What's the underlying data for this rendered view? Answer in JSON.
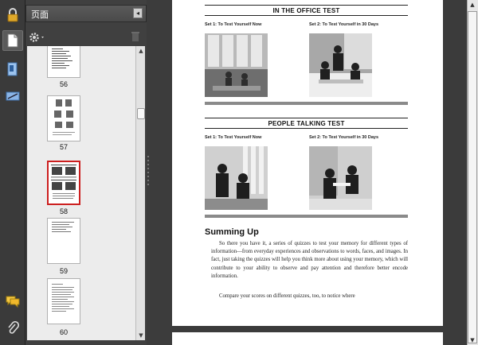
{
  "panel": {
    "title": "页面",
    "collapse_glyph": "◂",
    "gear_icon": "gear-icon",
    "trash_icon": "trash-icon"
  },
  "toolbar": {
    "items": [
      {
        "name": "lock-icon"
      },
      {
        "name": "page-thumbnails-icon"
      },
      {
        "name": "bookmark-icon"
      },
      {
        "name": "signature-icon"
      },
      {
        "name": "comment-icon"
      },
      {
        "name": "attachment-icon"
      }
    ]
  },
  "thumbnails": [
    {
      "page": "56"
    },
    {
      "page": "57"
    },
    {
      "page": "58",
      "selected": true
    },
    {
      "page": "59"
    },
    {
      "page": "60"
    }
  ],
  "document": {
    "section1": {
      "title": "IN THE OFFICE TEST",
      "set1": "Set 1: To Test Yourself Now",
      "set2": "Set 2: To Test Yourself in 30 Days"
    },
    "section2": {
      "title": "PEOPLE TALKING TEST",
      "set1": "Set 1: To Test Yourself Now",
      "set2": "Set 2: To Test Yourself in 30 Days"
    },
    "summing_up": {
      "title": "Summing Up",
      "paragraph1": "So there you have it, a series of quizzes to test your memory for different types of information—from everyday experiences and observations to words, faces, and images. In fact, just taking the quizzes will help you think more about using your memory, which will contribute to your ability to observe and pay attention and therefore better encode information.",
      "paragraph2": "Compare your scores on different quizzes, too, to notice where"
    }
  },
  "colors": {
    "background": "#3b3b3b",
    "selected_thumb": "#cc1f1f",
    "panel": "#404040"
  }
}
